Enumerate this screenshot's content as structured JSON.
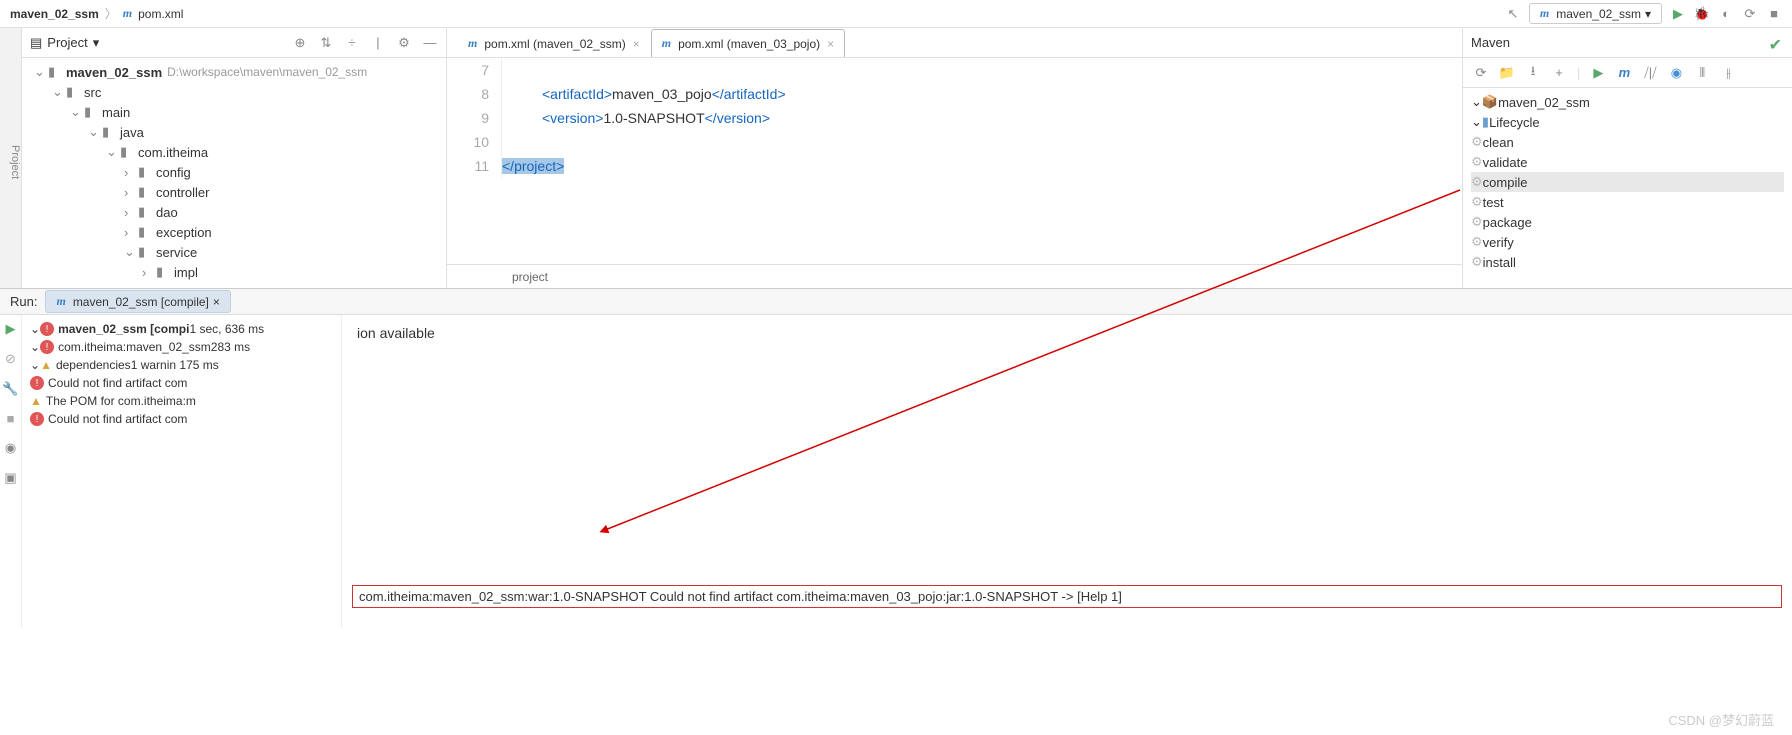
{
  "breadcrumb": {
    "project": "maven_02_ssm",
    "file": "pom.xml"
  },
  "topbar": {
    "runconfig": "maven_02_ssm"
  },
  "project": {
    "title": "Project",
    "root": "maven_02_ssm",
    "rootPath": "D:\\workspace\\maven\\maven_02_ssm",
    "src": "src",
    "main": "main",
    "java": "java",
    "pkg": "com.itheima",
    "folders": [
      "config",
      "controller",
      "dao",
      "exception",
      "service"
    ],
    "impl": "impl"
  },
  "editor": {
    "tab1": "pom.xml (maven_02_ssm)",
    "tab2": "pom.xml (maven_03_pojo)",
    "lines": {
      "l7": "",
      "l8_open": "<artifactId>",
      "l8_val": "maven_03_pojo",
      "l8_close": "</artifactId>",
      "l9_open": "<version>",
      "l9_val": "1.0-SNAPSHOT",
      "l9_close": "</version>",
      "l11": "</project>"
    },
    "crumb": "project"
  },
  "maven": {
    "title": "Maven",
    "root": "maven_02_ssm",
    "lifecycle": "Lifecycle",
    "phases": [
      "clean",
      "validate",
      "compile",
      "test",
      "package",
      "verify",
      "install"
    ]
  },
  "run": {
    "title": "Run:",
    "tab": "maven_02_ssm [compile]",
    "root": "maven_02_ssm [compi",
    "rootTime": "1 sec, 636 ms",
    "module": "com.itheima:maven_02_ssm",
    "moduleTime": "283 ms",
    "deps": "dependencies",
    "depsWarn": "1 warnin",
    "depsTime": "175 ms",
    "err1": "Could not find artifact com",
    "warn1": "The POM for com.itheima:m",
    "err2": "Could not find artifact com",
    "console_top": "ion available",
    "error_line": "com.itheima:maven_02_ssm:war:1.0-SNAPSHOT  Could not find artifact com.itheima:maven_03_pojo:jar:1.0-SNAPSHOT -> [Help 1]"
  },
  "watermark": "CSDN @梦幻蔚蓝"
}
